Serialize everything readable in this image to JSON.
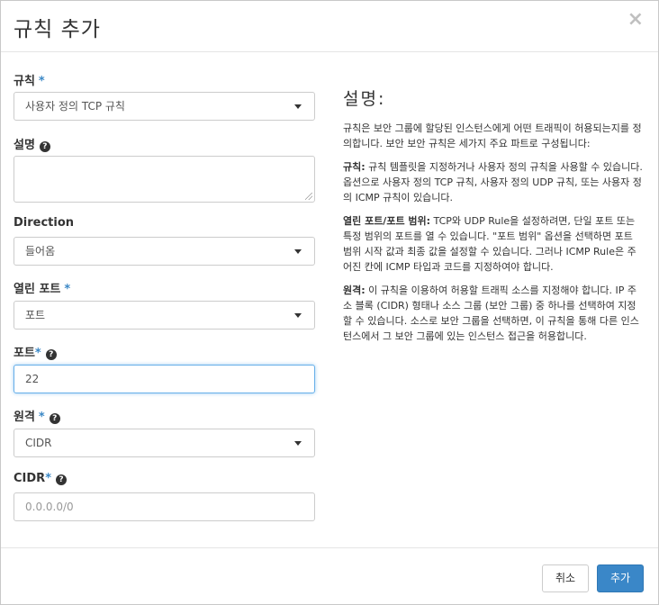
{
  "header": {
    "title": "규칙 추가",
    "close_glyph": "×"
  },
  "form": {
    "rule": {
      "label": "규칙",
      "required_mark": "*",
      "value": "사용자 정의 TCP 규칙"
    },
    "description": {
      "label": "설명",
      "help_glyph": "?"
    },
    "direction": {
      "label": "Direction",
      "value": "들어옴"
    },
    "open_port": {
      "label": "열린 포트",
      "required_mark": "*",
      "value": "포트"
    },
    "port": {
      "label": "포트",
      "required_mark": "*",
      "help_glyph": "?",
      "value": "22"
    },
    "remote": {
      "label": "원격",
      "required_mark": "*",
      "help_glyph": "?",
      "value": "CIDR"
    },
    "cidr": {
      "label": "CIDR",
      "required_mark": "*",
      "help_glyph": "?",
      "placeholder": "0.0.0.0/0"
    }
  },
  "help_panel": {
    "title": "설명:",
    "intro": "규칙은 보안 그룹에 할당된 인스턴스에게 어떤 트래픽이 허용되는지를 정의합니다. 보안 보안 규칙은 세가지 주요 파트로 구성됩니다:",
    "rule_term": "규칙:",
    "rule_text": " 규칙 템플릿을 지정하거나 사용자 정의 규칙을 사용할 수 있습니다. 옵션으로 사용자 정의 TCP 규칙, 사용자 정의 UDP 규칙, 또는 사용자 정의 ICMP 규칙이 있습니다.",
    "port_term": "열린 포트/포트 범위:",
    "port_text": " TCP와 UDP Rule을 설정하려면, 단일 포트 또는 특정 범위의 포트를 열 수 있습니다. \"포트 범위\" 옵션을 선택하면 포트 범위 시작 값과 최종 값을 설정할 수 있습니다. 그러나 ICMP Rule은 주어진 칸에 ICMP 타입과 코드를 지정하여야 합니다.",
    "remote_term": "원격:",
    "remote_text": " 이 규칙을 이용하여 허용할 트래픽 소스를 지정해야 합니다. IP 주소 블록 (CIDR) 형태나 소스 그룹 (보안 그룹) 중 하나를 선택하여 지정할 수 있습니다. 소스로 보안 그룹을 선택하면, 이 규칙을 통해 다른 인스턴스에서 그 보안 그룹에 있는 인스턴스 접근을 허용합니다."
  },
  "footer": {
    "cancel_label": "취소",
    "add_label": "추가"
  },
  "colors": {
    "accent": "#3a87c8",
    "required": "#3b88c6",
    "focus_border": "#66afe9"
  }
}
